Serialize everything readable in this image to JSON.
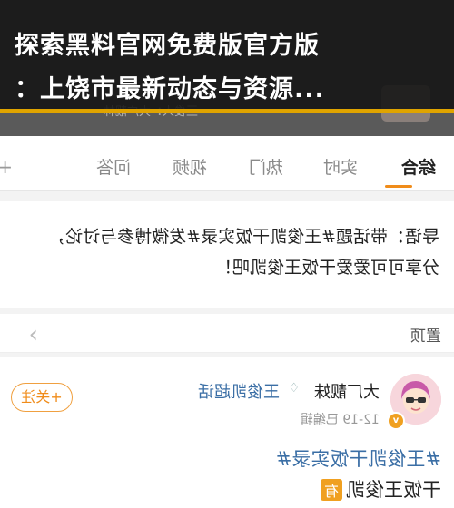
{
  "headline": {
    "line1": "探索黑料官网免费版官方版",
    "line2": "：上饶市最新动态与资源..."
  },
  "colors": {
    "overlay": "#121212",
    "accent": "#e0a400",
    "tab_active_underline": "#f08c1a",
    "topic_link": "#3a6ea5"
  },
  "top_strip": {
    "subtitle": "王俊人：大广靓林"
  },
  "tabs": {
    "items": [
      {
        "label": "综合",
        "active": true
      },
      {
        "label": "实时",
        "active": false
      },
      {
        "label": "热门",
        "active": false
      },
      {
        "label": "视频",
        "active": false
      },
      {
        "label": "问答",
        "active": false
      }
    ],
    "add_icon": "plus-icon"
  },
  "intro": {
    "line1": "导语：带话题#王俊凯干饭实录#发微博参与讨论，",
    "line2": "分享可可爱爱干饭王俊凯吧！"
  },
  "pinned": {
    "label": "置顶",
    "chevron_icon": "chevron-right-icon"
  },
  "post": {
    "username": "大厂靓妹",
    "topic": "王俊凯超话",
    "date": "12-19",
    "edited": "已编辑",
    "follow_label": "+关注",
    "hashtag": "#王俊凯干饭实录#",
    "text": "干饭王俊凯",
    "chip": "有"
  }
}
